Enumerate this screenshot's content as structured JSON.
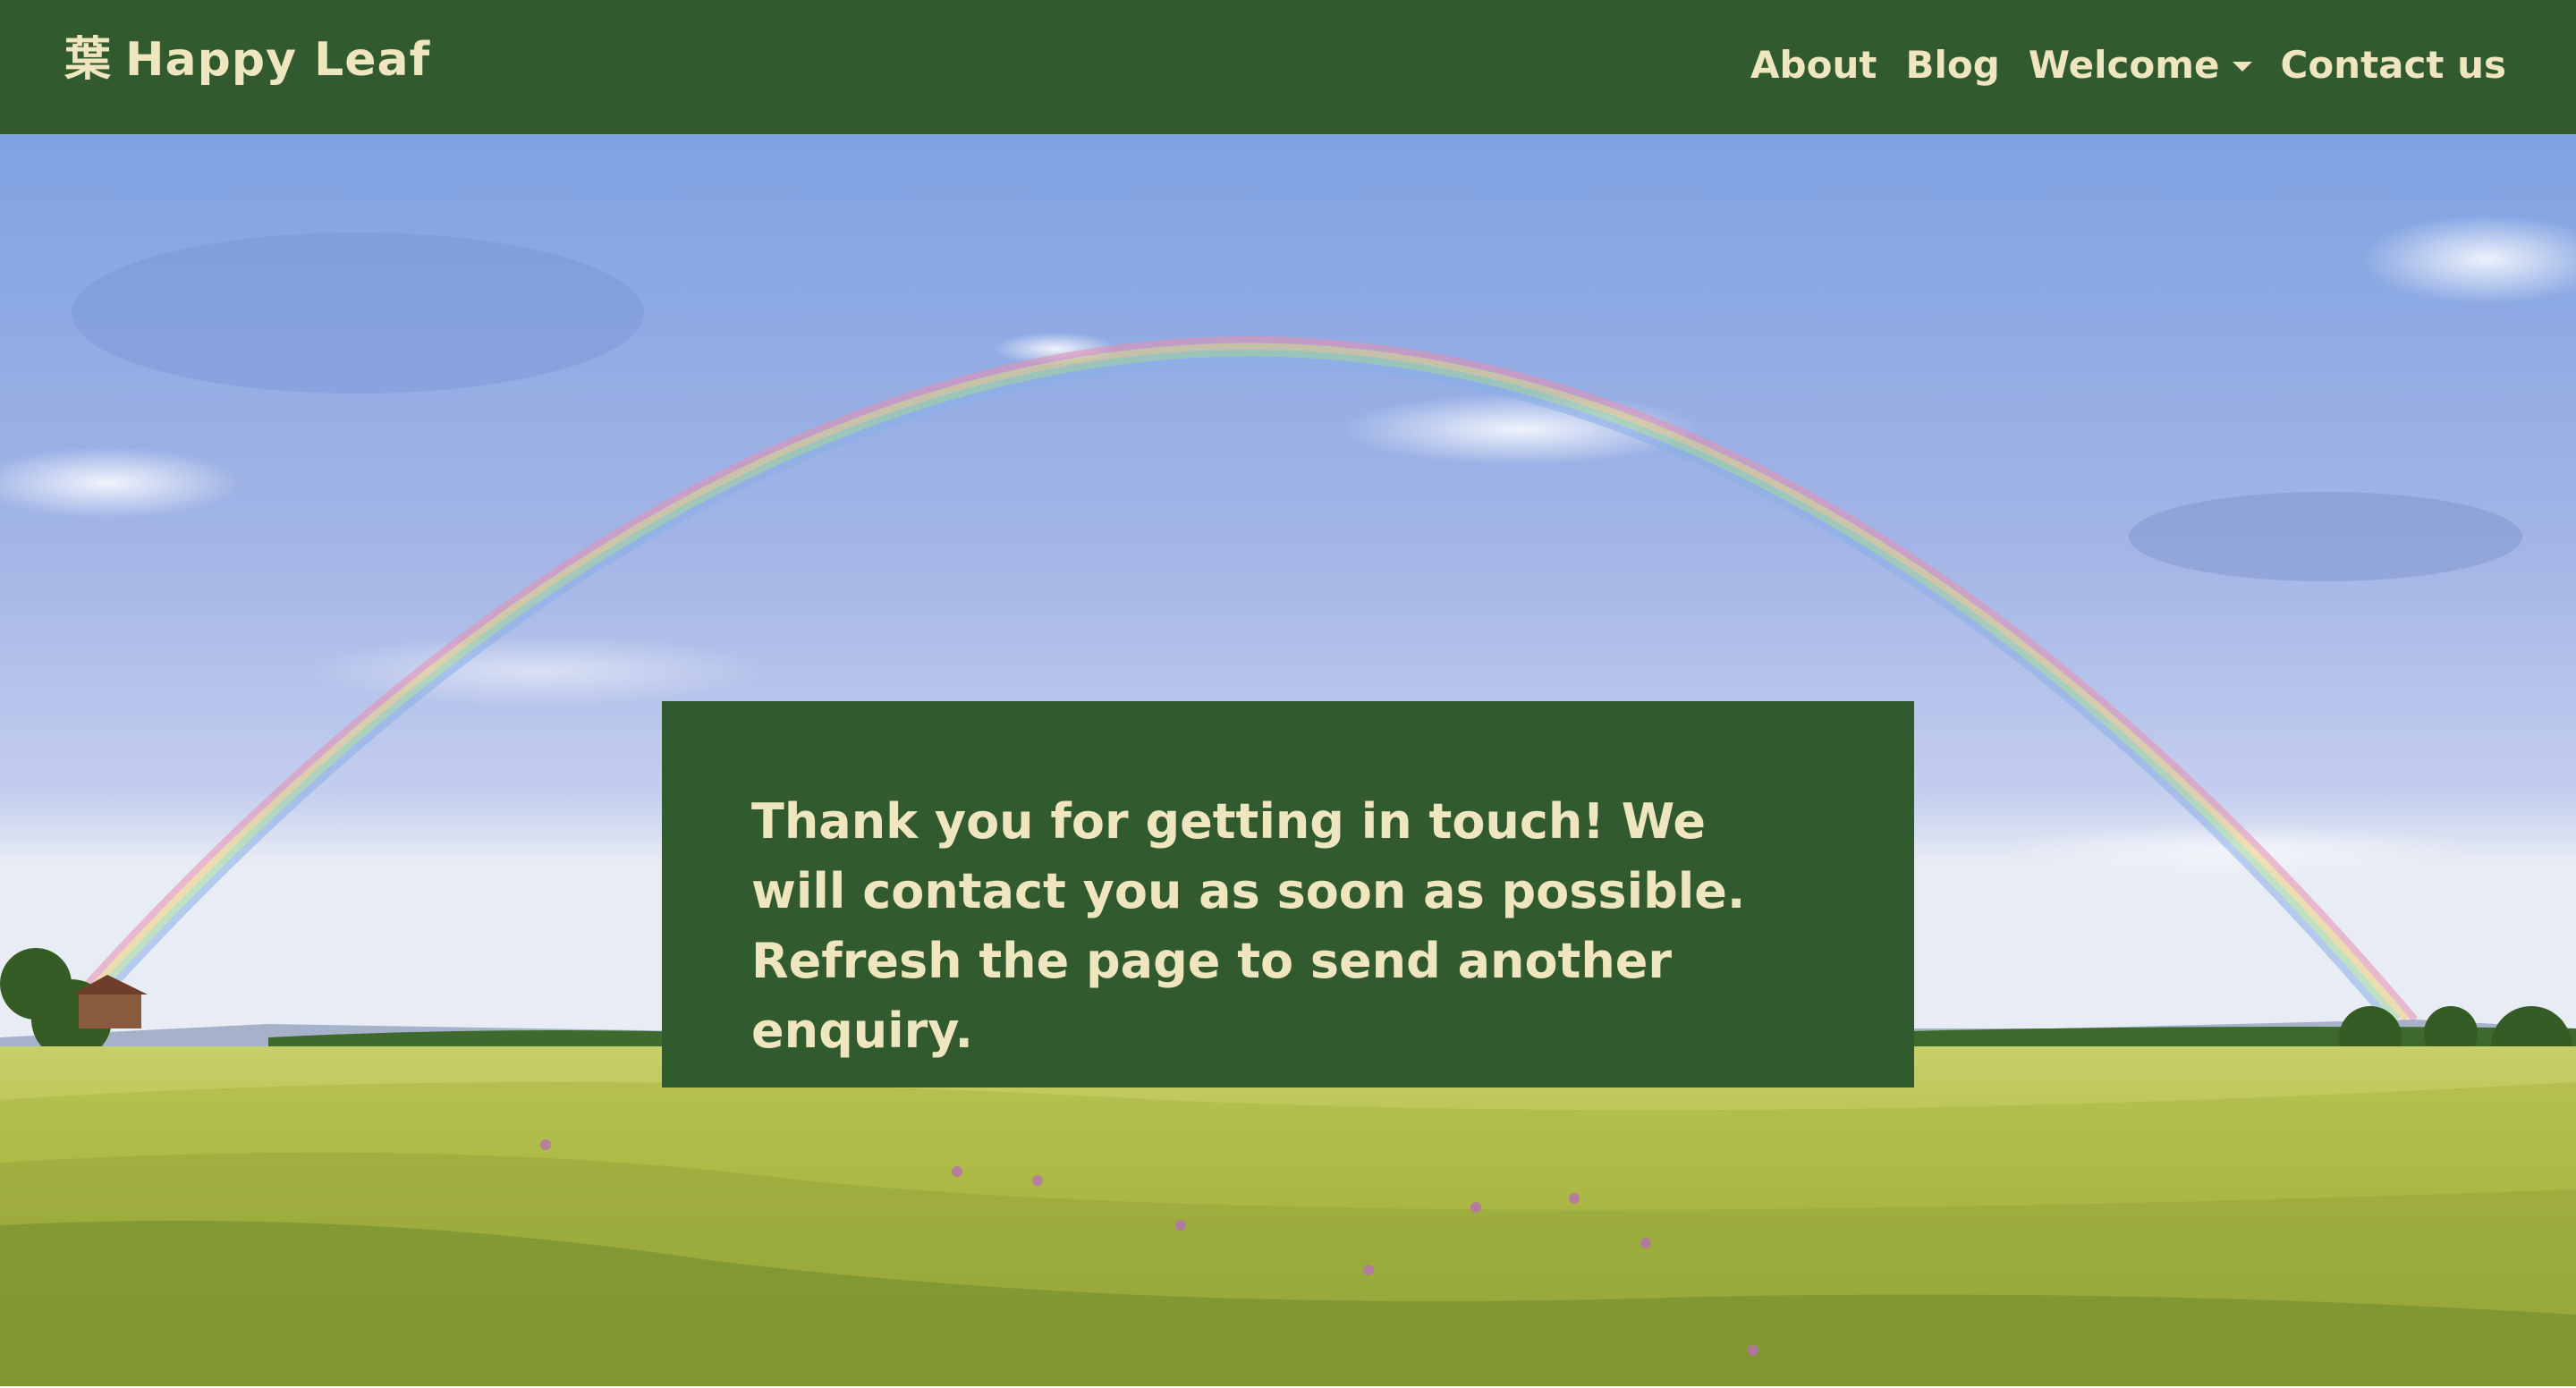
{
  "navbar": {
    "brand_glyph": "葉",
    "brand_name": "Happy Leaf",
    "links": [
      {
        "label": "About"
      },
      {
        "label": "Blog"
      },
      {
        "label": "Welcome",
        "has_dropdown": true
      },
      {
        "label": "Contact us"
      }
    ]
  },
  "hero": {
    "image": "rainbow-over-wheat-field",
    "message": "Thank you for getting in touch! We will contact you as soon as possible. Refresh the page to send another enquiry."
  },
  "colors": {
    "nav_bg": "#315a2f",
    "panel_bg": "#315a2f",
    "text_cream": "#efe6bf"
  }
}
